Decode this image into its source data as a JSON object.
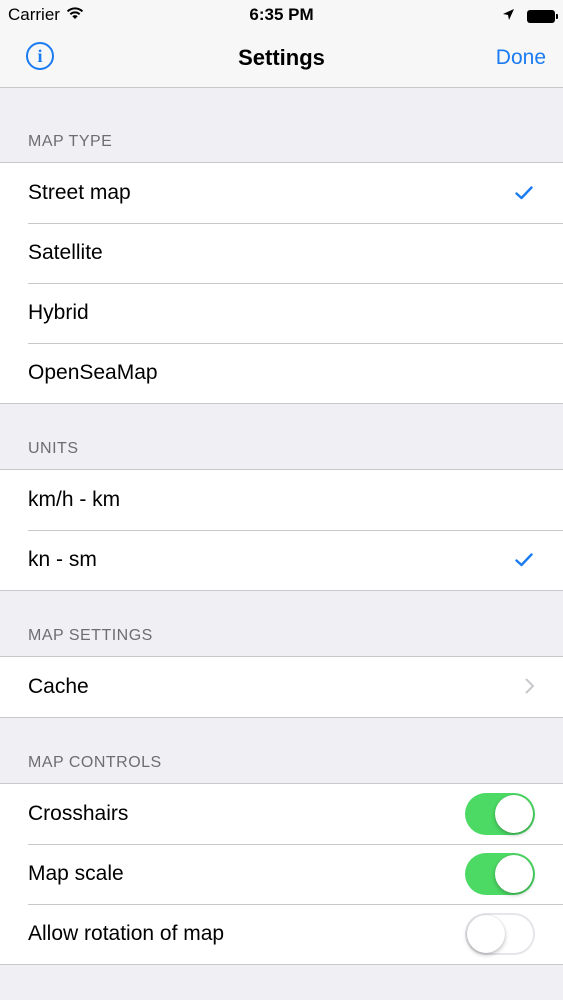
{
  "status_bar": {
    "carrier": "Carrier",
    "time": "6:35 PM"
  },
  "nav": {
    "info_label": "i",
    "title": "Settings",
    "done_label": "Done"
  },
  "sections": {
    "map_type": {
      "header": "MAP TYPE",
      "items": [
        {
          "label": "Street map",
          "checked": true
        },
        {
          "label": "Satellite",
          "checked": false
        },
        {
          "label": "Hybrid",
          "checked": false
        },
        {
          "label": "OpenSeaMap",
          "checked": false
        }
      ]
    },
    "units": {
      "header": "UNITS",
      "items": [
        {
          "label": "km/h - km",
          "checked": false
        },
        {
          "label": "kn - sm",
          "checked": true
        }
      ]
    },
    "map_settings": {
      "header": "MAP SETTINGS",
      "items": [
        {
          "label": "Cache"
        }
      ]
    },
    "map_controls": {
      "header": "MAP CONTROLS",
      "items": [
        {
          "label": "Crosshairs",
          "on": true
        },
        {
          "label": "Map scale",
          "on": true
        },
        {
          "label": "Allow rotation of map",
          "on": false
        }
      ]
    }
  },
  "colors": {
    "accent": "#1b7cf2",
    "toggle_on": "#4cd964",
    "background": "#efeff4"
  }
}
